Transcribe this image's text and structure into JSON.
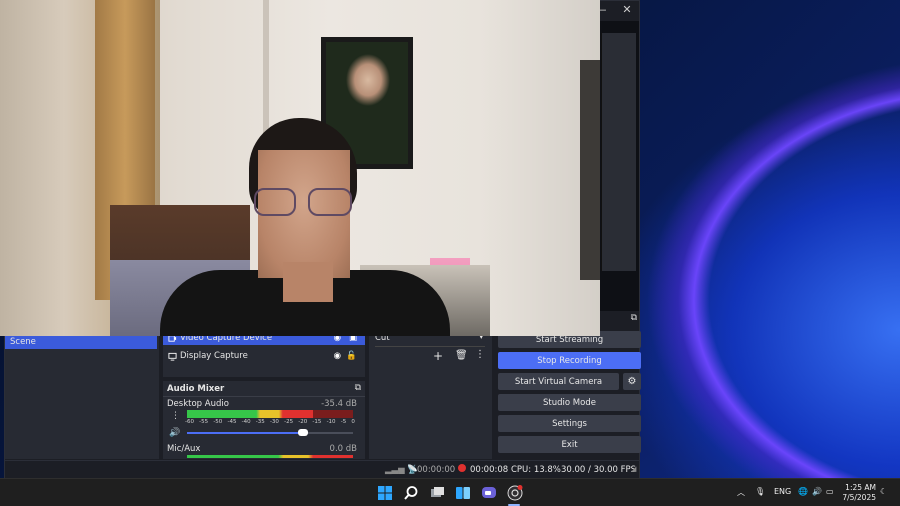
{
  "window": {
    "minimize_glyph": "—",
    "close_glyph": "✕"
  },
  "scenes": {
    "partial_label": "Scene"
  },
  "sources": {
    "items": [
      {
        "label": "Video Capture Device",
        "icon": "camera-icon",
        "selected": true
      },
      {
        "label": "Display Capture",
        "icon": "monitor-icon",
        "selected": false
      }
    ]
  },
  "transition": {
    "selected": "Cut"
  },
  "controls": {
    "start_streaming": "Start Streaming",
    "stop_recording": "Stop Recording",
    "start_virtual_camera": "Start Virtual Camera",
    "studio_mode": "Studio Mode",
    "settings": "Settings",
    "exit": "Exit"
  },
  "audio_mixer": {
    "title": "Audio Mixer",
    "tick_labels": [
      "-60",
      "-55",
      "-50",
      "-45",
      "-40",
      "-35",
      "-30",
      "-25",
      "-20",
      "-15",
      "-10",
      "-5",
      "0"
    ],
    "channels": [
      {
        "name": "Desktop Audio",
        "db": "-35.4 dB",
        "level": 0.76,
        "volume": 0.7
      },
      {
        "name": "Mic/Aux",
        "db": "0.0 dB",
        "level": 0.0,
        "volume": 1.0
      }
    ]
  },
  "status": {
    "stream_time": "00:00:00",
    "record_time": "00:00:08",
    "cpu": "CPU: 13.8%",
    "fps": "30.00 / 30.00 FPS"
  },
  "taskbar": {
    "apps": [
      "windows-start-icon",
      "search-icon",
      "task-view-icon",
      "widgets-icon",
      "chat-icon",
      "obs-icon"
    ],
    "tray_lang": "ENG",
    "time": "1:25 AM",
    "date": "7/5/2025"
  },
  "colors": {
    "accent": "#4c6ef5",
    "selection": "#3b5bdb",
    "panel": "#272a33",
    "record_red": "#e0312f"
  }
}
